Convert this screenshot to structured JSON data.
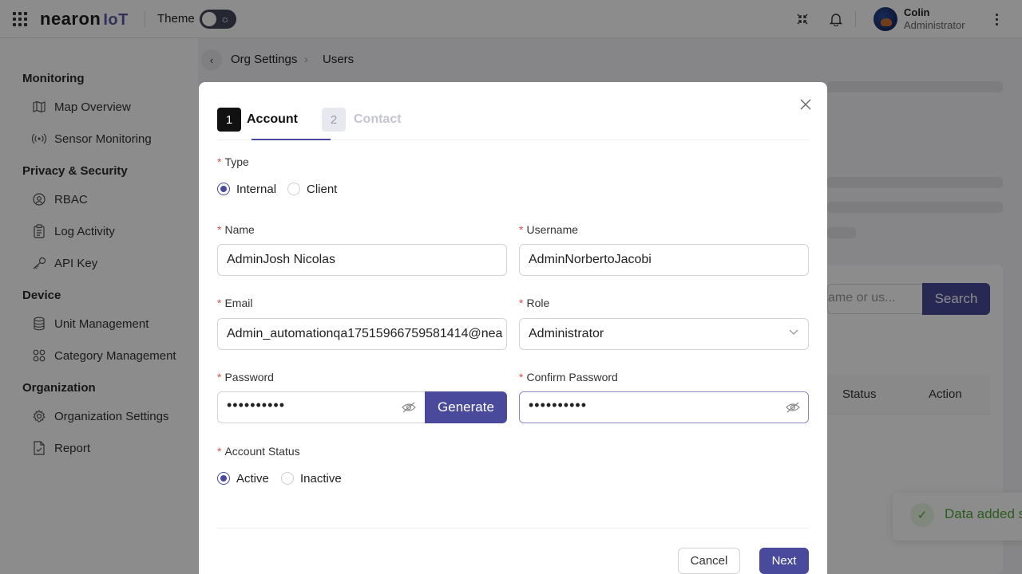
{
  "topbar": {
    "logo_main": "nearon",
    "logo_suffix": "IoT",
    "theme_label": "Theme",
    "user_name": "Colin",
    "user_role": "Administrator"
  },
  "sidebar": {
    "sections": [
      {
        "title": "Monitoring",
        "items": [
          "Map Overview",
          "Sensor Monitoring"
        ]
      },
      {
        "title": "Privacy & Security",
        "items": [
          "RBAC",
          "Log Activity",
          "API Key"
        ]
      },
      {
        "title": "Device",
        "items": [
          "Unit Management",
          "Category Management"
        ]
      },
      {
        "title": "Organization",
        "items": [
          "Organization Settings",
          "Report"
        ]
      }
    ]
  },
  "breadcrumb": {
    "parent": "Org Settings",
    "current": "Users"
  },
  "background": {
    "search_placeholder": "ame or us...",
    "search_button": "Search",
    "columns": [
      "Status",
      "Action"
    ],
    "toast": "Data added s"
  },
  "modal": {
    "steps": [
      {
        "num": "1",
        "label": "Account",
        "active": true
      },
      {
        "num": "2",
        "label": "Contact",
        "active": false
      }
    ],
    "type_label": "Type",
    "type_options": [
      "Internal",
      "Client"
    ],
    "type_selected": "Internal",
    "name_label": "Name",
    "name_value": "AdminJosh Nicolas",
    "username_label": "Username",
    "username_value": "AdminNorbertoJacobi",
    "email_label": "Email",
    "email_value": "Admin_automationqa17515966759581414@nea",
    "role_label": "Role",
    "role_value": "Administrator",
    "password_label": "Password",
    "password_value": "••••••••••",
    "generate_label": "Generate",
    "confirm_label": "Confirm Password",
    "confirm_value": "••••••••••",
    "status_label": "Account Status",
    "status_options": [
      "Active",
      "Inactive"
    ],
    "status_selected": "Active",
    "cancel_label": "Cancel",
    "next_label": "Next",
    "required_mark": "*"
  },
  "colors": {
    "accent": "#4a4a9c",
    "success": "#52a83a",
    "required": "#e05050"
  }
}
